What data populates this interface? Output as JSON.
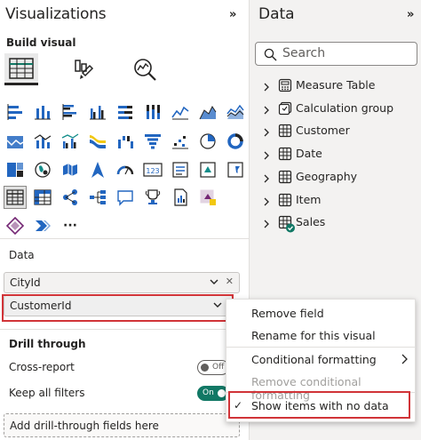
{
  "visualizations": {
    "title": "Visualizations",
    "collapse_glyph": "»",
    "build_visual_label": "Build visual",
    "mode_icons": [
      "build-visual-icon",
      "format-visual-icon",
      "analytics-icon"
    ],
    "more_label": "···",
    "data_section_label": "Data",
    "fields": [
      {
        "label": "CityId"
      },
      {
        "label": "CustomerId"
      }
    ],
    "drill_through": {
      "label": "Drill through",
      "cross_report_label": "Cross-report",
      "cross_report_toggle": "Off",
      "keep_filters_label": "Keep all filters",
      "keep_filters_toggle": "On",
      "drop_placeholder": "Add drill-through fields here"
    }
  },
  "data_pane": {
    "title": "Data",
    "collapse_glyph": "»",
    "search_placeholder": "Search",
    "tables": [
      {
        "label": "Measure Table",
        "icon": "measure-table-icon"
      },
      {
        "label": "Calculation group",
        "icon": "calculation-group-icon"
      },
      {
        "label": "Customer",
        "icon": "table-icon"
      },
      {
        "label": "Date",
        "icon": "table-icon"
      },
      {
        "label": "Geography",
        "icon": "table-icon"
      },
      {
        "label": "Item",
        "icon": "table-icon"
      },
      {
        "label": "Sales",
        "icon": "table-with-check-icon"
      }
    ]
  },
  "context_menu": {
    "items": [
      {
        "label": "Remove field",
        "enabled": true
      },
      {
        "label": "Rename for this visual",
        "enabled": true
      },
      {
        "label": "Conditional formatting",
        "enabled": true,
        "submenu": true
      },
      {
        "label": "Remove conditional formatting",
        "enabled": false
      },
      {
        "label": "Show items with no data",
        "enabled": true,
        "checked": true,
        "check_glyph": "✓"
      }
    ]
  },
  "colors": {
    "highlight_red": "#d13438",
    "toggle_on": "#117865",
    "accent_blue": "#2266c0",
    "accent_teal": "#128d8a"
  }
}
